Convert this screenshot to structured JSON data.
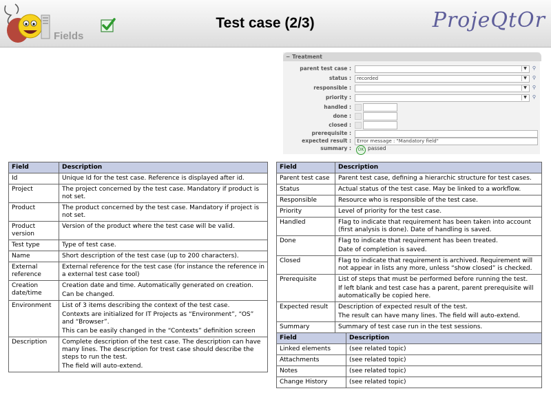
{
  "header": {
    "logo_text": "Fields",
    "title": "Test case (2/3)",
    "brand": "ProjeQtOr"
  },
  "form": {
    "section_title": "Treatment",
    "fields": {
      "parent_test_case": {
        "label": "parent test case :",
        "value": ""
      },
      "status": {
        "label": "status :",
        "value": "recorded"
      },
      "responsible": {
        "label": "responsible :",
        "value": ""
      },
      "priority": {
        "label": "priority :",
        "value": ""
      },
      "handled": {
        "label": "handled :"
      },
      "done": {
        "label": "done :"
      },
      "closed": {
        "label": "closed :"
      },
      "prerequisite": {
        "label": "prerequisite :",
        "value": ""
      },
      "expected_result": {
        "label": "expected result :",
        "value": "Error message : \"Mandatory field\""
      },
      "summary": {
        "label": "summary :",
        "value": "passed"
      }
    }
  },
  "left_table": {
    "headers": [
      "Field",
      "Description"
    ],
    "rows": [
      {
        "field": "Id",
        "desc": [
          "Unique Id for the test case. Reference is displayed after id."
        ]
      },
      {
        "field": "Project",
        "desc": [
          "The project concerned by the test case. Mandatory if product is not set."
        ]
      },
      {
        "field": "Product",
        "desc": [
          "The product concerned by the test case. Mandatory if project is not set."
        ]
      },
      {
        "field": "Product version",
        "desc": [
          "Version of the product where the test case will be valid."
        ]
      },
      {
        "field": "Test type",
        "desc": [
          "Type of test case."
        ]
      },
      {
        "field": "Name",
        "desc": [
          "Short description of the test case (up to 200 characters)."
        ]
      },
      {
        "field": "External reference",
        "desc": [
          "External reference for the test case (for instance the reference in a external test case tool)"
        ]
      },
      {
        "field": "Creation date/time",
        "desc": [
          "Creation date and time. Automatically generated on creation.",
          "Can be changed."
        ]
      },
      {
        "field": "Environment",
        "desc": [
          "List of 3 items describing the context of the test case.",
          "Contexts are initialized for IT Projects as “Environment”, “OS” and “Browser”.",
          "This can be easily changed in the “Contexts” definition screen"
        ]
      },
      {
        "field": "Description",
        "desc": [
          "Complete description of the test case. The description can have many lines. The description for trest case should describe the steps to run the test.",
          "The field will auto-extend."
        ]
      }
    ]
  },
  "right_table": {
    "headers": [
      "Field",
      "Description"
    ],
    "rows": [
      {
        "field": "Parent test case",
        "desc": [
          "Parent test case, defining a hierarchic structure for test cases."
        ]
      },
      {
        "field": "Status",
        "desc": [
          "Actual status of the test case. May be linked to a workflow."
        ]
      },
      {
        "field": "Responsible",
        "desc": [
          "Resource who is responsible of the test case."
        ]
      },
      {
        "field": "Priority",
        "desc": [
          "Level of priority for the test case."
        ]
      },
      {
        "field": "Handled",
        "desc": [
          "Flag to indicate that requirement has been taken into account (first analysis is done). Date of handling is saved."
        ]
      },
      {
        "field": "Done",
        "desc": [
          "Flag to indicate that requirement has been treated.",
          "Date of completion is saved."
        ]
      },
      {
        "field": "Closed",
        "desc": [
          "Flag to indicate that requirement is archived. Requirement will not appear in lists any more, unless “show closed” is checked."
        ]
      },
      {
        "field": "Prerequisite",
        "desc": [
          "List of steps that must be performed before running the test.",
          "If left blank and test case has a parent, parent prerequisite will automatically be copied here."
        ]
      },
      {
        "field": "Expected result",
        "desc": [
          "Description of expected result of the test.",
          "The result can have many lines. The field will auto-extend."
        ]
      },
      {
        "field": "Summary",
        "desc": [
          "Summary of test case run in the test sessions."
        ]
      }
    ]
  },
  "linked_table": {
    "headers": [
      "Field",
      "Description"
    ],
    "rows": [
      {
        "field": "Linked elements",
        "desc": "(see related topic)"
      },
      {
        "field": "Attachments",
        "desc": "(see related topic)"
      },
      {
        "field": "Notes",
        "desc": "(see related topic)"
      },
      {
        "field": "Change History",
        "desc": "(see related topic)"
      }
    ]
  }
}
